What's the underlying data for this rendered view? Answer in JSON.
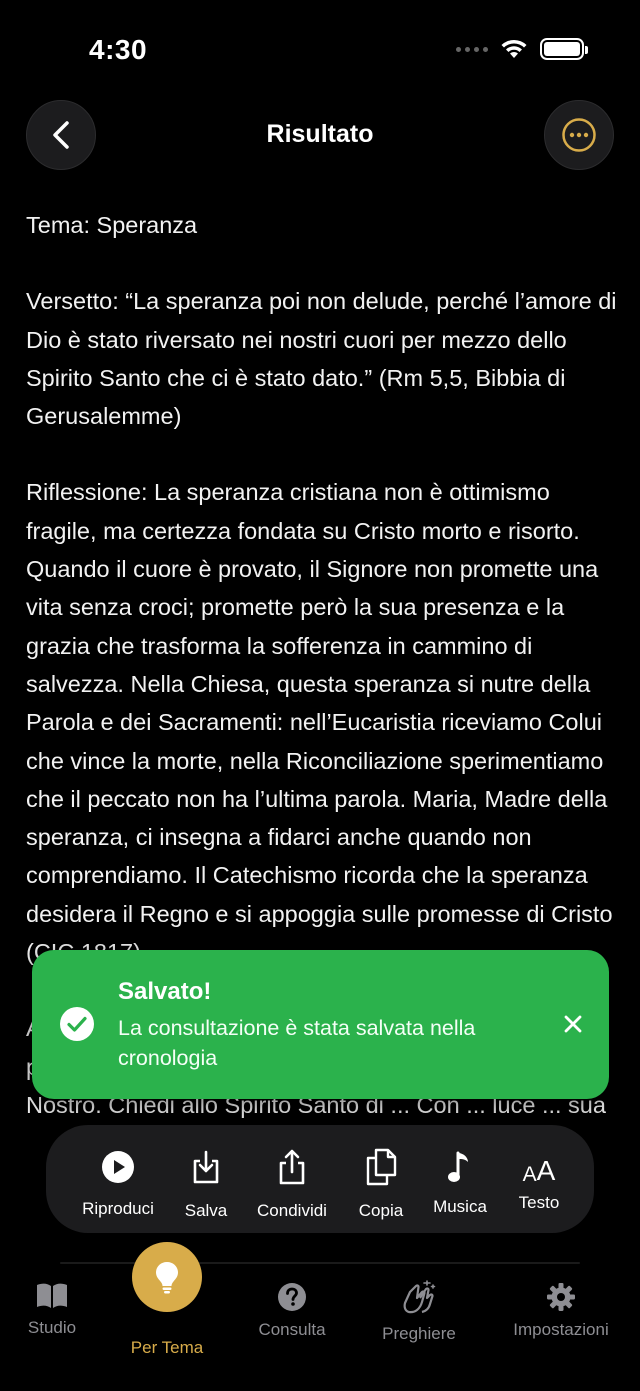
{
  "status_bar": {
    "time": "4:30"
  },
  "header": {
    "title": "Risultato"
  },
  "content": {
    "theme": "Tema: Speranza",
    "verse": "Versetto: “La speranza poi non delude, perché l’amore di Dio è stato riversato nei nostri cuori per mezzo dello Spirito Santo che ci è stato dato.” (Rm 5,5, Bibbia di Gerusalemme)",
    "reflection": "Riflessione: La speranza cristiana non è ottimismo fragile, ma certezza fondata su Cristo morto e risorto. Quando il cuore è provato, il Signore non promette una vita senza croci; promette però la sua presenza e la grazia che trasforma la sofferenza in cammino di salvezza. Nella Chiesa, questa speranza si nutre della Parola e dei Sacramenti: nell’Eucaristia riceviamo Colui che vince la morte, nella Riconciliazione sperimentiamo che il peccato non ha l’ultima parola. Maria, Madre della speranza, ci insegna a fidarci anche quando non comprendiamo. Il Catechismo ricorda che la speranza desidera il Regno e si appoggia sulle promesse di Cristo (CIC 1817).",
    "application": "Applicazione pratica: Oggi affida a Gesù una preoccupazione concreta e recita lentamente un Padre Nostro. Chiedi allo Spirito Santo di ... Con ... luce ... sua"
  },
  "toast": {
    "title": "Salvato!",
    "message": "La consultazione è stata salvata nella cronologia",
    "icon": "checkmark-circle-icon",
    "color": "#2bb24c"
  },
  "actions": [
    {
      "label": "Riproduci",
      "icon": "play-circle-icon"
    },
    {
      "label": "Salva",
      "icon": "download-icon"
    },
    {
      "label": "Condividi",
      "icon": "share-icon"
    },
    {
      "label": "Copia",
      "icon": "copy-icon"
    },
    {
      "label": "Musica",
      "icon": "music-note-icon"
    },
    {
      "label": "Testo",
      "icon": "text-size-icon"
    }
  ],
  "tabs": [
    {
      "label": "Studio",
      "icon": "book-icon",
      "active": false
    },
    {
      "label": "Per Tema",
      "icon": "lightbulb-icon",
      "active": true
    },
    {
      "label": "Consulta",
      "icon": "question-circle-icon",
      "active": false
    },
    {
      "label": "Preghiere",
      "icon": "praying-hands-icon",
      "active": false
    },
    {
      "label": "Impostazioni",
      "icon": "gear-icon",
      "active": false
    }
  ],
  "colors": {
    "accent": "#d8ac4a",
    "success": "#2bb24c",
    "background": "#000000",
    "inactive": "#8e8e93"
  }
}
